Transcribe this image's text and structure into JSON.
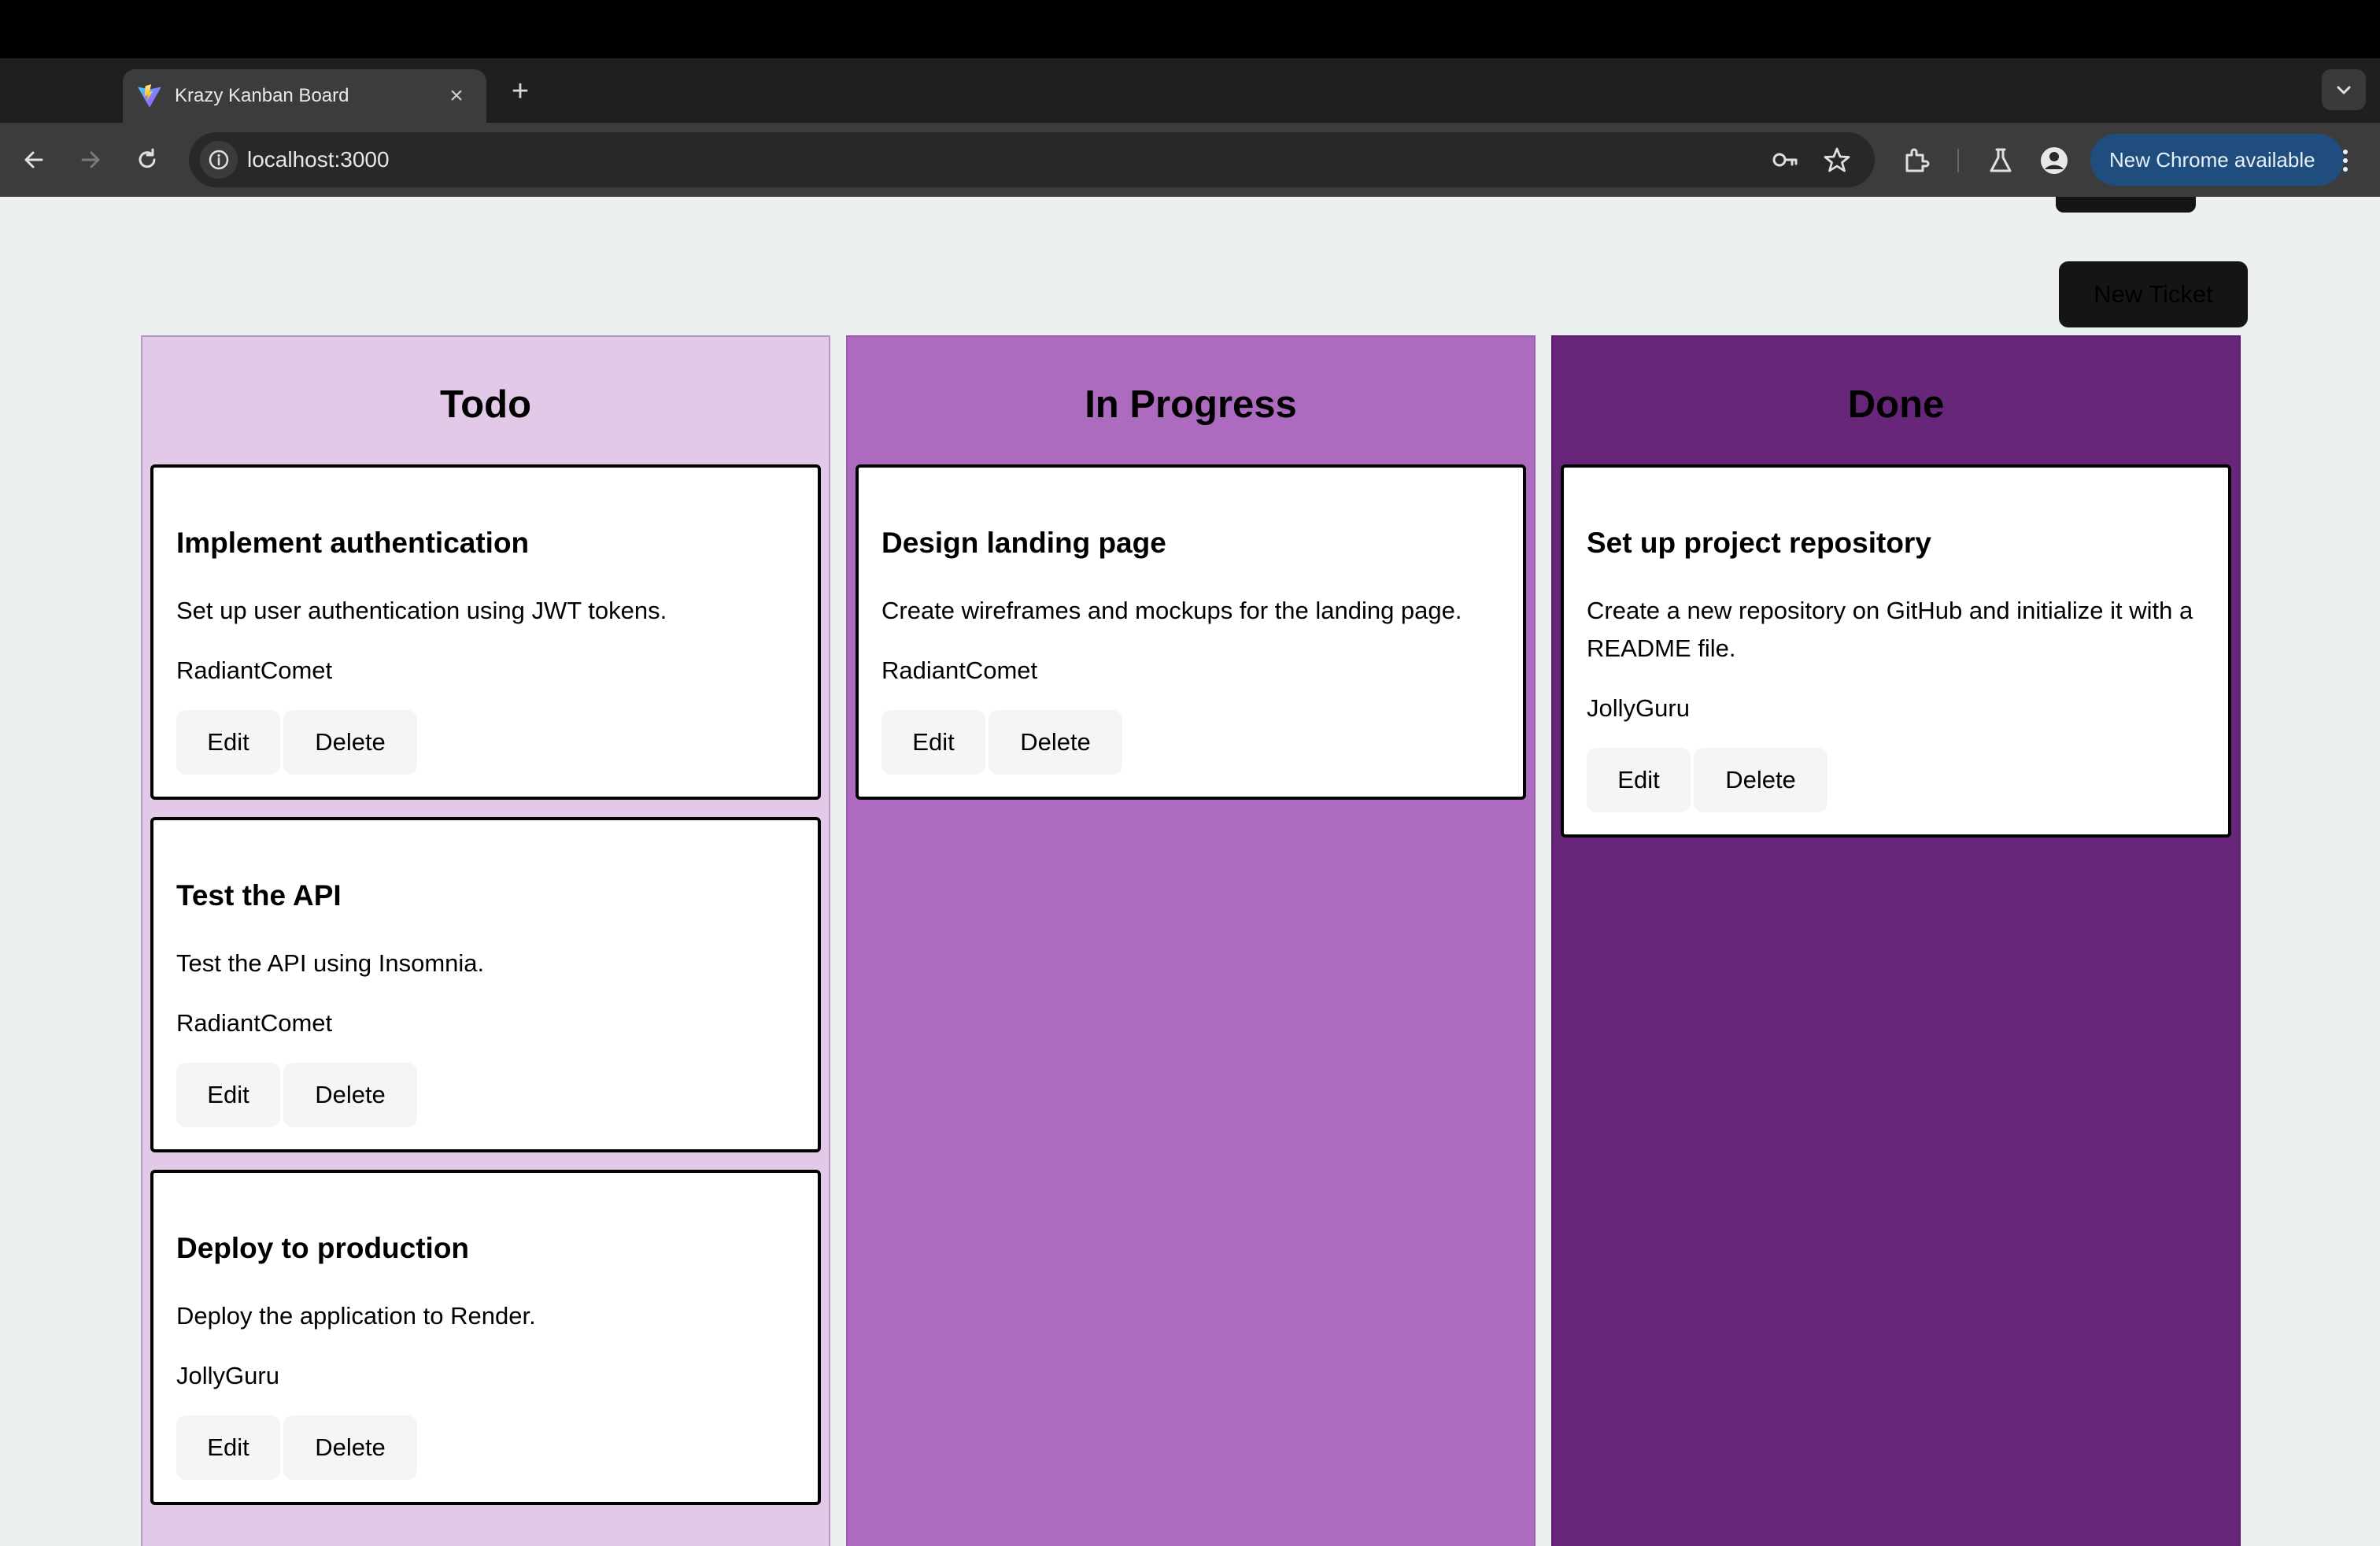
{
  "browser": {
    "tab": {
      "title": "Krazy Kanban Board"
    },
    "new_tab_symbol": "+",
    "close_symbol": "×",
    "address": {
      "url": "localhost:3000"
    },
    "update_button": {
      "label": "New Chrome available"
    },
    "icons": [
      "back-icon",
      "forward-icon",
      "reload-icon",
      "site-info-icon",
      "password-key-icon",
      "bookmark-star-icon",
      "extensions-icon",
      "labs-flask-icon",
      "profile-icon",
      "kebab-menu-icon",
      "tab-search-icon"
    ]
  },
  "toolbar": {
    "new_ticket_label": "New Ticket"
  },
  "columns": [
    {
      "title": "Todo",
      "color": "#e3c9e8",
      "cards": [
        {
          "title": "Implement authentication",
          "description": "Set up user authentication using JWT tokens.",
          "assignee": "RadiantComet",
          "edit_label": "Edit",
          "delete_label": "Delete"
        },
        {
          "title": "Test the API",
          "description": "Test the API using Insomnia.",
          "assignee": "RadiantComet",
          "edit_label": "Edit",
          "delete_label": "Delete"
        },
        {
          "title": "Deploy to production",
          "description": "Deploy the application to Render.",
          "assignee": "JollyGuru",
          "edit_label": "Edit",
          "delete_label": "Delete"
        }
      ]
    },
    {
      "title": "In Progress",
      "color": "#ad6bc0",
      "cards": [
        {
          "title": "Design landing page",
          "description": "Create wireframes and mockups for the landing page.",
          "assignee": "RadiantComet",
          "edit_label": "Edit",
          "delete_label": "Delete"
        }
      ]
    },
    {
      "title": "Done",
      "color": "#68267a",
      "cards": [
        {
          "title": "Set up project repository",
          "description": "Create a new repository on GitHub and initialize it with a README file.",
          "assignee": "JollyGuru",
          "edit_label": "Edit",
          "delete_label": "Delete"
        }
      ]
    }
  ]
}
